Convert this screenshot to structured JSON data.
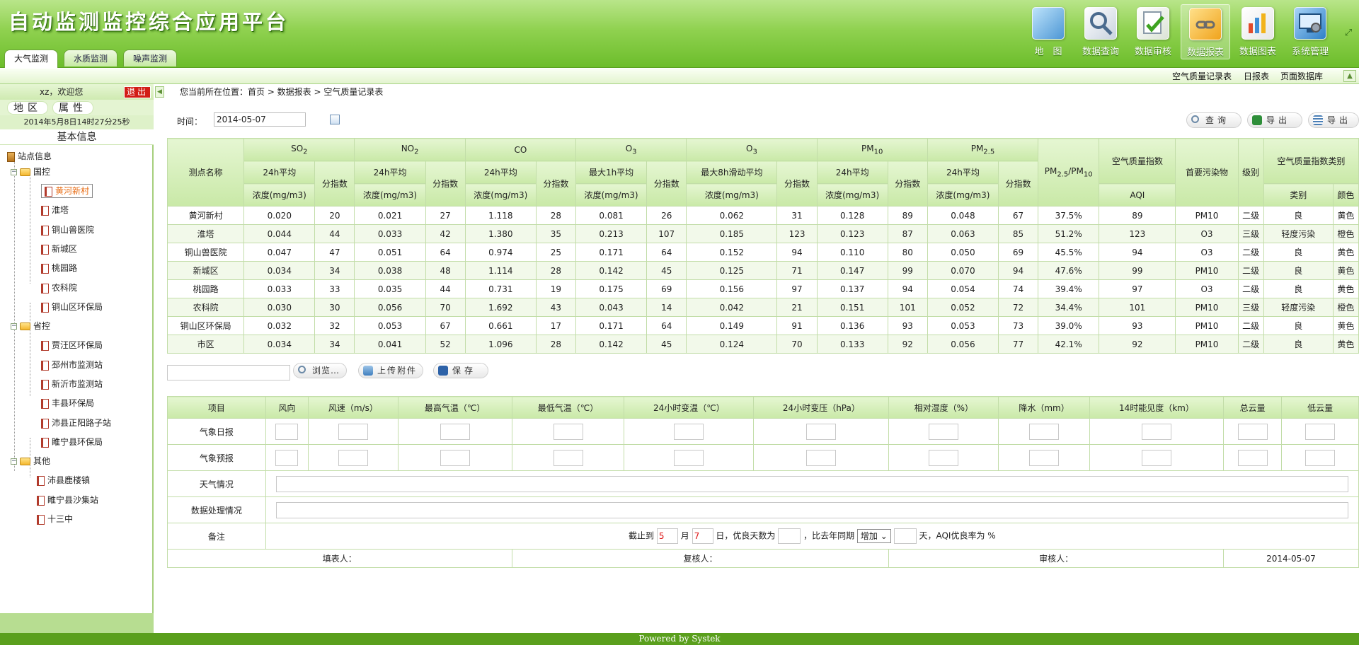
{
  "app": {
    "title": "自动监测监控综合应用平台"
  },
  "tabs": [
    "大气监测",
    "水质监测",
    "噪声监测"
  ],
  "topnav": [
    {
      "label": "地　图",
      "icon": "map-icon",
      "color": "#5aa5e0"
    },
    {
      "label": "数据查询",
      "icon": "magnifier-icon",
      "color": "#dfe7ef"
    },
    {
      "label": "数据审核",
      "icon": "check-document-icon",
      "color": "#e9efe6"
    },
    {
      "label": "数据报表",
      "icon": "link-folder-icon",
      "color": "#f3b626"
    },
    {
      "label": "数据图表",
      "icon": "bar-chart-icon",
      "color": "#f7f7f7"
    },
    {
      "label": "系统管理",
      "icon": "monitor-gear-icon",
      "color": "#4c9ad8"
    }
  ],
  "sublinks": [
    "空气质量记录表",
    "日报表",
    "页面数据库"
  ],
  "sidebar": {
    "welcome": "xz，欢迎您",
    "logout": "退出",
    "tabs": [
      "地区",
      "属性"
    ],
    "clock": "2014年5月8日14时27分25秒",
    "basic_info": "基本信息",
    "tree": {
      "root": "站点信息",
      "groups": [
        {
          "name": "国控",
          "items": [
            "黄河新村",
            "淮塔",
            "铜山兽医院",
            "新城区",
            "桃园路",
            "农科院",
            "铜山区环保局"
          ]
        },
        {
          "name": "省控",
          "items": [
            "贾汪区环保局",
            "邳州市监测站",
            "新沂市监测站",
            "丰县环保局",
            "沛县正阳路子站",
            "睢宁县环保局"
          ]
        },
        {
          "name": "其他",
          "items": [
            "沛县鹿楼镇",
            "睢宁县沙集站",
            "十三中"
          ]
        }
      ],
      "selected": "黄河新村"
    }
  },
  "breadcrumb": "您当前所在位置：首页 > 数据报表 > 空气质量记录表",
  "filter": {
    "date_label": "时间：",
    "date_value": "2014-05-07"
  },
  "toolbar": {
    "query": "查询",
    "export1": "导出",
    "export2": "导出"
  },
  "aq_table": {
    "station_header": "测点名称",
    "pollutants": [
      "SO",
      "NO",
      "CO",
      "O",
      "O",
      "PM",
      "PM"
    ],
    "pollutant_subs": [
      "2",
      "2",
      "",
      "3",
      "3",
      "10",
      "2.5"
    ],
    "avg_labels": [
      "24h平均",
      "24h平均",
      "24h平均",
      "最大1h平均",
      "最大8h滑动平均",
      "24h平均",
      "24h平均"
    ],
    "conc_label": "浓度(mg/m3)",
    "index_label": "分指数",
    "ratio_header_a": "PM",
    "ratio_sub_a": "2.5",
    "ratio_mid": "/PM",
    "ratio_sub_b": "10",
    "aqi_header": "空气质量指数",
    "aqi_sub": "AQI",
    "primary_header": "首要污染物",
    "level_header": "级别",
    "class_header": "空气质量指数类别",
    "class_sub": "类别",
    "color_sub": "颜色",
    "rows": [
      [
        "黄河新村",
        "0.020",
        "20",
        "0.021",
        "27",
        "1.118",
        "28",
        "0.081",
        "26",
        "0.062",
        "31",
        "0.128",
        "89",
        "0.048",
        "67",
        "37.5%",
        "89",
        "PM10",
        "二级",
        "良",
        "黄色"
      ],
      [
        "淮塔",
        "0.044",
        "44",
        "0.033",
        "42",
        "1.380",
        "35",
        "0.213",
        "107",
        "0.185",
        "123",
        "0.123",
        "87",
        "0.063",
        "85",
        "51.2%",
        "123",
        "O3",
        "三级",
        "轻度污染",
        "橙色"
      ],
      [
        "铜山兽医院",
        "0.047",
        "47",
        "0.051",
        "64",
        "0.974",
        "25",
        "0.171",
        "64",
        "0.152",
        "94",
        "0.110",
        "80",
        "0.050",
        "69",
        "45.5%",
        "94",
        "O3",
        "二级",
        "良",
        "黄色"
      ],
      [
        "新城区",
        "0.034",
        "34",
        "0.038",
        "48",
        "1.114",
        "28",
        "0.142",
        "45",
        "0.125",
        "71",
        "0.147",
        "99",
        "0.070",
        "94",
        "47.6%",
        "99",
        "PM10",
        "二级",
        "良",
        "黄色"
      ],
      [
        "桃园路",
        "0.033",
        "33",
        "0.035",
        "44",
        "0.731",
        "19",
        "0.175",
        "69",
        "0.156",
        "97",
        "0.137",
        "94",
        "0.054",
        "74",
        "39.4%",
        "97",
        "O3",
        "二级",
        "良",
        "黄色"
      ],
      [
        "农科院",
        "0.030",
        "30",
        "0.056",
        "70",
        "1.692",
        "43",
        "0.043",
        "14",
        "0.042",
        "21",
        "0.151",
        "101",
        "0.052",
        "72",
        "34.4%",
        "101",
        "PM10",
        "三级",
        "轻度污染",
        "橙色"
      ],
      [
        "铜山区环保局",
        "0.032",
        "32",
        "0.053",
        "67",
        "0.661",
        "17",
        "0.171",
        "64",
        "0.149",
        "91",
        "0.136",
        "93",
        "0.053",
        "73",
        "39.0%",
        "93",
        "PM10",
        "二级",
        "良",
        "黄色"
      ],
      [
        "市区",
        "0.034",
        "34",
        "0.041",
        "52",
        "1.096",
        "28",
        "0.142",
        "45",
        "0.124",
        "70",
        "0.133",
        "92",
        "0.056",
        "77",
        "42.1%",
        "92",
        "PM10",
        "二级",
        "良",
        "黄色"
      ]
    ]
  },
  "upload": {
    "browse": "浏览…",
    "attach": "上传附件",
    "save": "保存"
  },
  "met_table": {
    "headers": [
      "项目",
      "风向",
      "风速（m/s）",
      "最高气温（℃）",
      "最低气温（℃）",
      "24小时变温（℃）",
      "24小时变压（hPa）",
      "相对湿度（%）",
      "降水（mm）",
      "14时能见度（km）",
      "总云量",
      "低云量"
    ],
    "row_labels": [
      "气象日报",
      "气象预报",
      "天气情况",
      "数据处理情况",
      "备注"
    ],
    "remark": {
      "prefix": "截止到",
      "month_value": "5",
      "month_unit": "月",
      "day_value": "7",
      "day_unit": "日，优良天数为",
      "compare_text": "，比去年同期",
      "select_value": "增加",
      "suffix": "天，AQI优良率为 %"
    },
    "sign": {
      "filler": "填表人：",
      "reviewer": "复核人：",
      "auditor": "审核人：",
      "date": "2014-05-07"
    }
  },
  "footer": "Powered by Systek"
}
